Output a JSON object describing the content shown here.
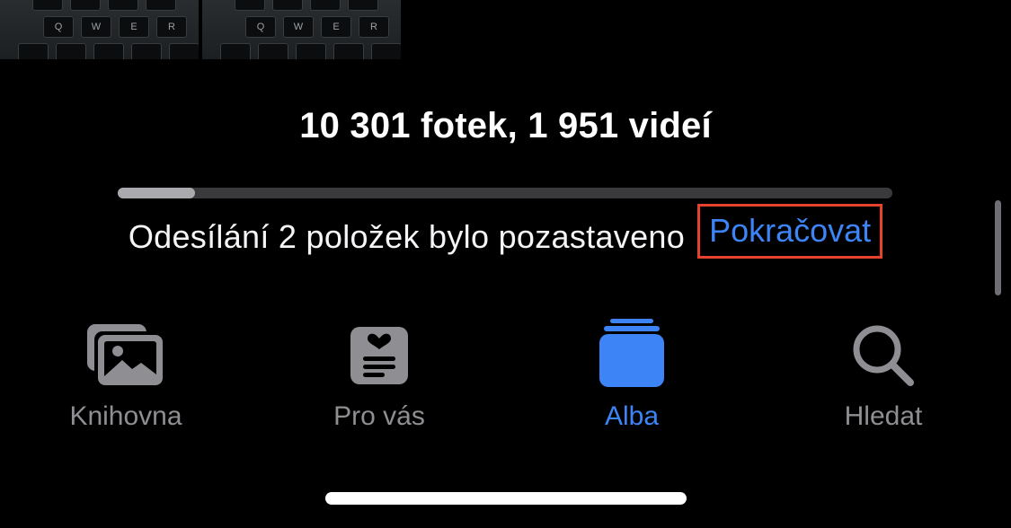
{
  "thumbnails": {
    "keys_row1": [
      "Q",
      "W",
      "E",
      "R"
    ],
    "keys_row2": [
      "Q",
      "W",
      "E",
      "R"
    ]
  },
  "library": {
    "count_title": "10 301 fotek, 1 951 videí",
    "upload_progress": 0.1
  },
  "status": {
    "message": "Odesílání 2 položek bylo pozastaveno",
    "resume_label": "Pokračovat"
  },
  "tabs": [
    {
      "label": "Knihovna",
      "icon": "photos-library-icon",
      "active": false
    },
    {
      "label": "Pro vás",
      "icon": "for-you-icon",
      "active": false
    },
    {
      "label": "Alba",
      "icon": "albums-icon",
      "active": true
    },
    {
      "label": "Hledat",
      "icon": "search-icon",
      "active": false
    }
  ],
  "colors": {
    "accent": "#3d84f6",
    "inactive": "#8e8e93",
    "highlight_box": "#e5432e",
    "background": "#000000"
  }
}
